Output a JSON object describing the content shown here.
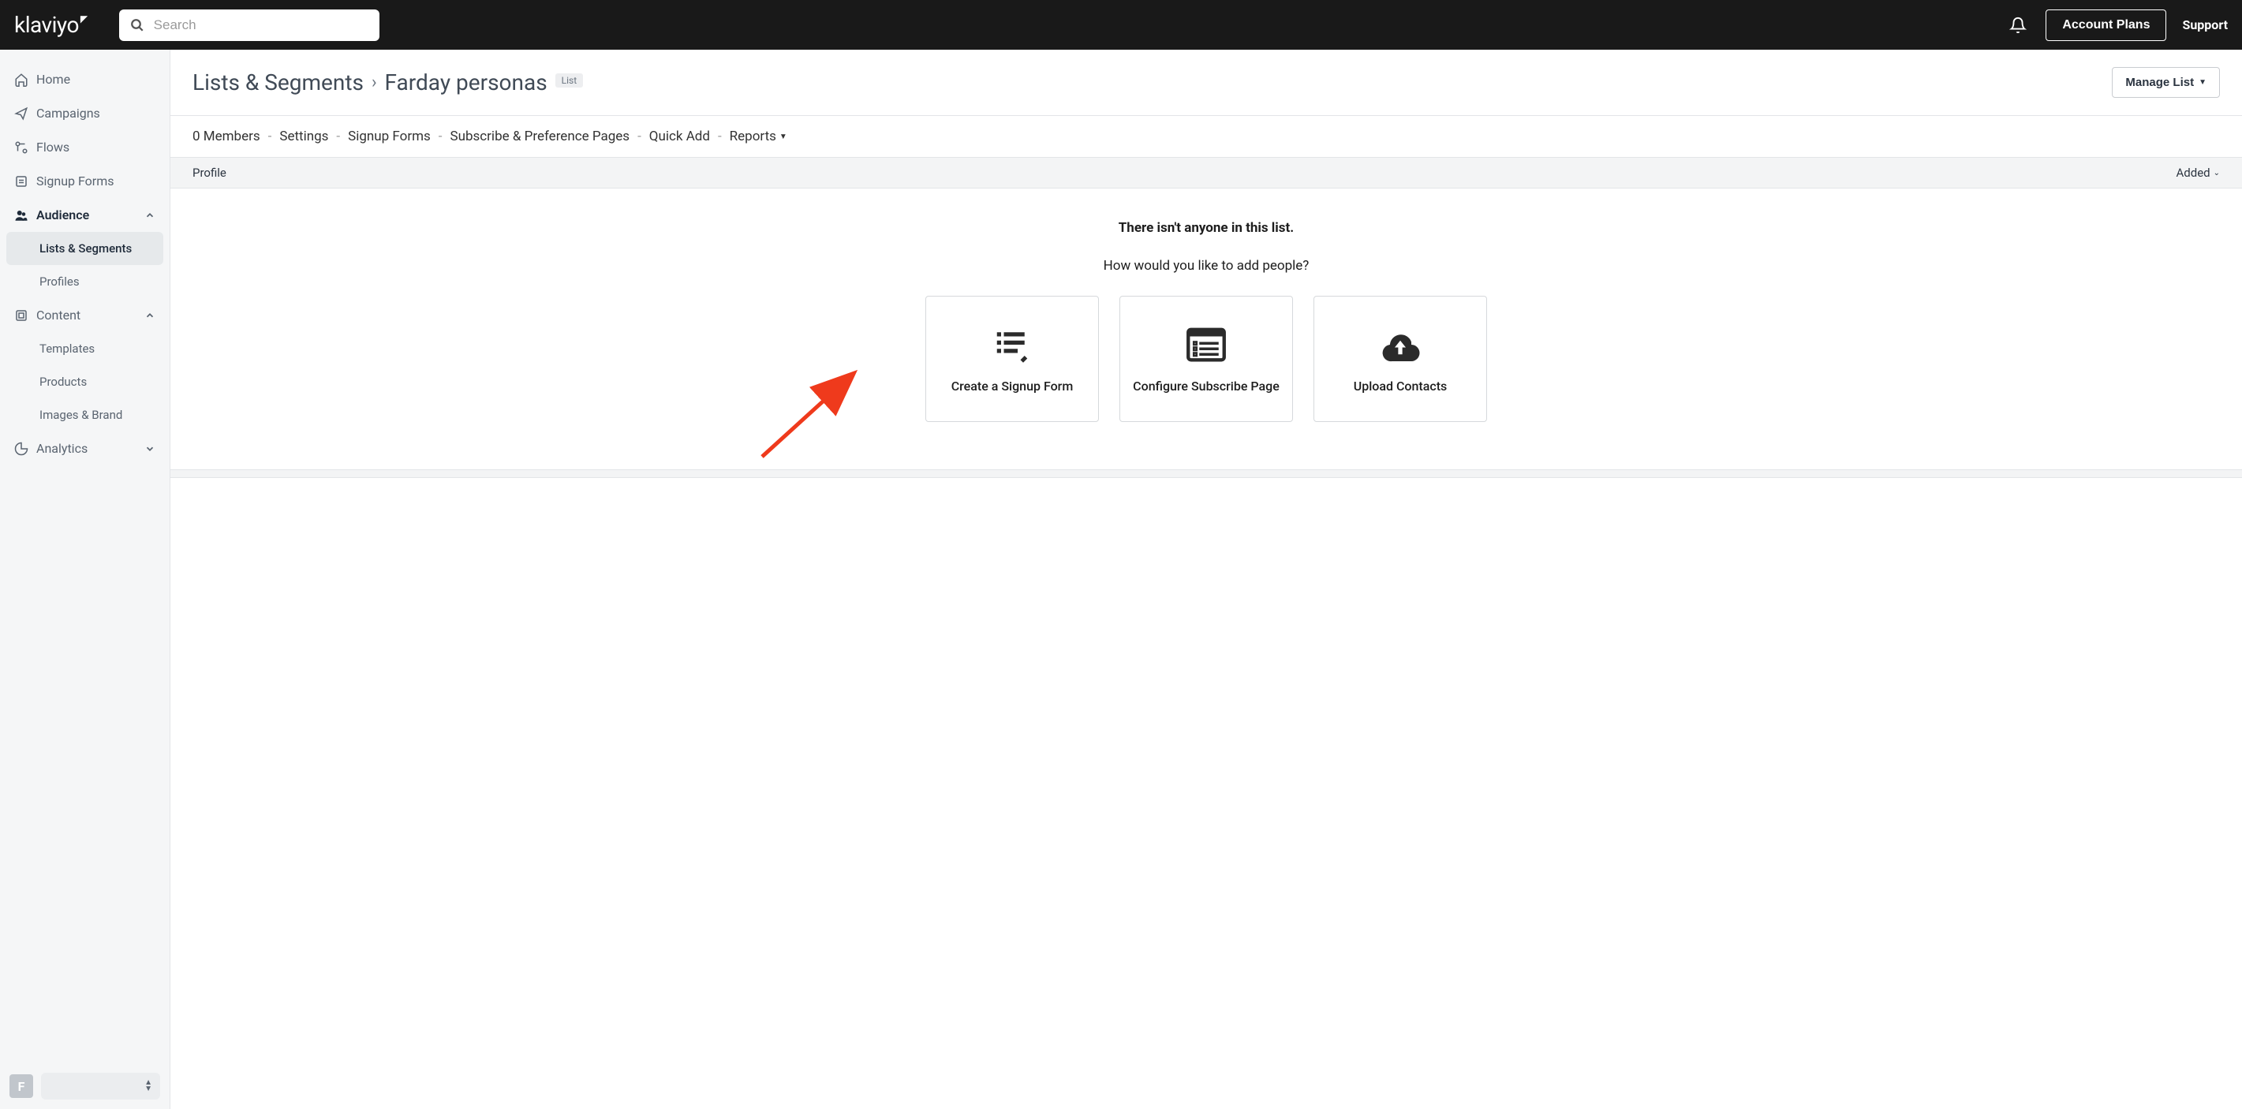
{
  "topbar": {
    "logo_text": "klaviyo",
    "search_placeholder": "Search",
    "account_plans": "Account Plans",
    "support": "Support"
  },
  "sidebar": {
    "items": [
      {
        "label": "Home"
      },
      {
        "label": "Campaigns"
      },
      {
        "label": "Flows"
      },
      {
        "label": "Signup Forms"
      },
      {
        "label": "Audience",
        "expanded": true,
        "children": [
          {
            "label": "Lists & Segments",
            "active": true
          },
          {
            "label": "Profiles"
          }
        ]
      },
      {
        "label": "Content",
        "expanded": true,
        "children": [
          {
            "label": "Templates"
          },
          {
            "label": "Products"
          },
          {
            "label": "Images & Brand"
          }
        ]
      },
      {
        "label": "Analytics"
      }
    ],
    "account_initial": "F"
  },
  "page": {
    "breadcrumb_root": "Lists & Segments",
    "breadcrumb_current": "Farday personas",
    "list_badge": "List",
    "manage_list": "Manage List",
    "tabs": {
      "members": "0 Members",
      "settings": "Settings",
      "signup_forms": "Signup Forms",
      "subscribe_pages": "Subscribe & Preference Pages",
      "quick_add": "Quick Add",
      "reports": "Reports"
    },
    "table": {
      "profile_col": "Profile",
      "added_col": "Added"
    },
    "empty": {
      "line1": "There isn't anyone in this list.",
      "line2": "How would you like to add people?",
      "card1": "Create a Signup Form",
      "card2": "Configure Subscribe Page",
      "card3": "Upload Contacts"
    }
  }
}
